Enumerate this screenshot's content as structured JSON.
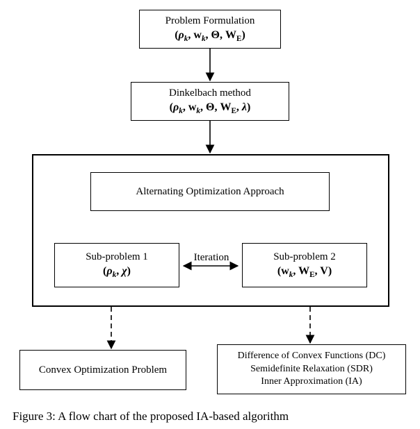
{
  "blocks": {
    "problem": {
      "title": "Problem Formulation",
      "math_html": "(<span class='it'>ρ</span><span class='sub'>k</span>, <span class='rm'>w</span><span class='sub'>k</span>, <span class='rm'>Θ</span>, <span class='rm'>W</span><span class='subrm'>E</span>)"
    },
    "dinkelbach": {
      "title": "Dinkelbach method",
      "math_html": "(<span class='it'>ρ</span><span class='sub'>k</span>, <span class='rm'>w</span><span class='sub'>k</span>, <span class='rm'>Θ</span>, <span class='rm'>W</span><span class='subrm'>E</span>, <span class='it'>λ</span>)"
    },
    "ao": {
      "title": "Alternating Optimization Approach"
    },
    "sub1": {
      "title": "Sub-problem 1",
      "math_html": "(<span class='it'>ρ</span><span class='sub'>k</span>, <span class='it'>χ</span>)"
    },
    "sub2": {
      "title": "Sub-problem 2",
      "math_html": "(<span class='rm'>w</span><span class='sub'>k</span>, <span class='rm'>W</span><span class='subrm'>E</span>, <span class='rm'>V</span>)"
    },
    "convex": {
      "line1": "Convex Optimization Problem"
    },
    "methods": {
      "line1": "Difference of Convex Functions (DC)",
      "line2": "Semidefinite Relaxation (SDR)",
      "line3": "Inner Approximation (IA)"
    }
  },
  "labels": {
    "iteration": "Iteration"
  },
  "caption_prefix": "Figure 3:",
  "caption_rest": " A flow chart of the proposed IA-based algorithm"
}
